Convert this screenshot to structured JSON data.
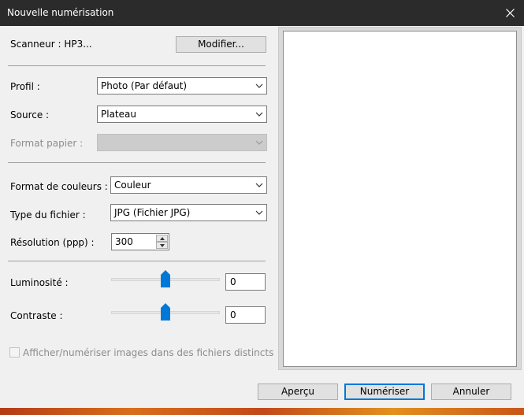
{
  "window": {
    "title": "Nouvelle numérisation",
    "close_icon": "close-icon"
  },
  "scanner": {
    "label": "Scanneur : HP3...",
    "change_button": "Modifier..."
  },
  "profile": {
    "label": "Profil :",
    "value": "Photo (Par défaut)"
  },
  "source": {
    "label": "Source :",
    "value": "Plateau"
  },
  "paper_format": {
    "label": "Format papier :",
    "value": ""
  },
  "color_format": {
    "label": "Format de couleurs :",
    "value": "Couleur"
  },
  "file_type": {
    "label": "Type du fichier :",
    "value": "JPG (Fichier JPG)"
  },
  "resolution": {
    "label": "Résolution (ppp) :",
    "value": "300"
  },
  "brightness": {
    "label": "Luminosité :",
    "value": "0",
    "slider_value": 0,
    "range": [
      -100,
      100
    ]
  },
  "contrast": {
    "label": "Contraste :",
    "value": "0",
    "slider_value": 0,
    "range": [
      -100,
      100
    ]
  },
  "separate_files": {
    "label": "Afficher/numériser images dans des fichiers distincts",
    "checked": false,
    "enabled": false
  },
  "buttons": {
    "preview": "Aperçu",
    "scan": "Numériser",
    "cancel": "Annuler"
  },
  "colors": {
    "titlebar": "#2b2b2b",
    "dialog_bg": "#f0f0f0",
    "accent": "#0078d7",
    "slider_thumb": "#0078d7"
  }
}
